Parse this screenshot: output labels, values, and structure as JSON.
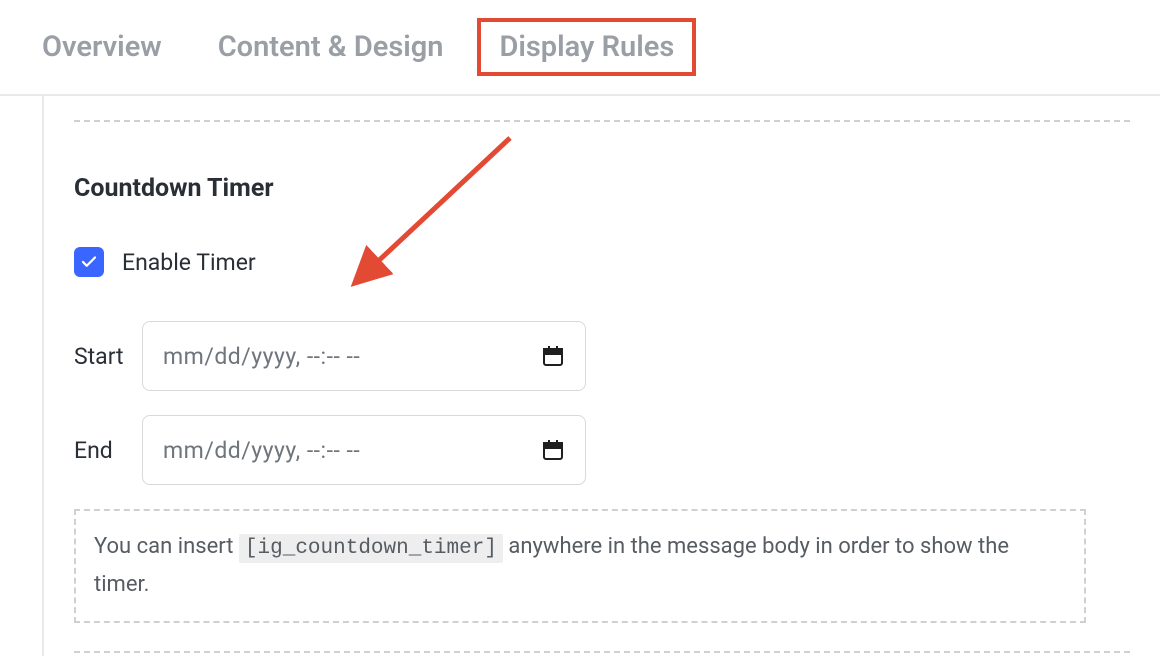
{
  "tabs": {
    "overview": "Overview",
    "content_design": "Content & Design",
    "display_rules": "Display Rules"
  },
  "section": {
    "title": "Countdown Timer",
    "enable_label": "Enable Timer",
    "enable_checked": true,
    "start_label": "Start",
    "end_label": "End",
    "date_placeholder": "mm/dd/yyyy, --:-- --",
    "hint_prefix": "You can insert ",
    "hint_code": "[ig_countdown_timer]",
    "hint_suffix": " anywhere in the message body in order to show the timer."
  },
  "colors": {
    "accent": "#3a66ff",
    "highlight_border": "#e34a33"
  }
}
